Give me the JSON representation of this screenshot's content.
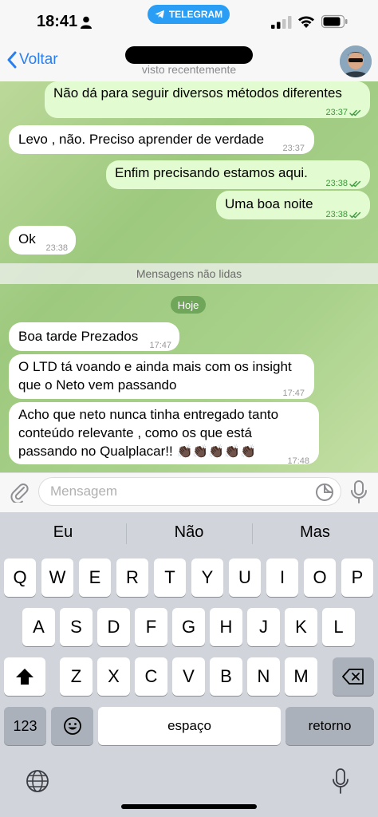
{
  "status_bar": {
    "time": "18:41",
    "app_pill": "TELEGRAM",
    "colors": {
      "pill": "#2a9df4"
    }
  },
  "header": {
    "back_label": "Voltar",
    "subtitle": "visto recentemente",
    "accent": "#2a7ff0"
  },
  "chat": {
    "messages": [
      {
        "dir": "out",
        "text": "Não dá para seguir diversos métodos diferentes",
        "time": "23:37"
      },
      {
        "dir": "in",
        "text": "Levo , não. Preciso aprender de verdade",
        "time": "23:37"
      },
      {
        "dir": "out",
        "text": "Enfim precisando estamos aqui.",
        "time": "23:38"
      },
      {
        "dir": "out",
        "text": "Uma boa noite",
        "time": "23:38"
      },
      {
        "dir": "in",
        "text": "Ok",
        "time": "23:38"
      },
      {
        "dir": "in",
        "text": "Boa tarde Prezados",
        "time": "17:47"
      },
      {
        "dir": "in",
        "line1": "O LTD tá voando e ainda mais com os insight",
        "line2": "que o Neto vem passando",
        "time": "17:47"
      },
      {
        "dir": "in",
        "line1": "Acho que neto nunca tinha entregado tanto",
        "line2": "conteúdo relevante , como os que está",
        "line3": "passando no Qualplacar!!",
        "emoji": "👏🏿👏🏿👏🏿👏🏿👏🏿",
        "time": "17:48"
      }
    ],
    "unread_label": "Mensagens não lidas",
    "date_label": "Hoje"
  },
  "composer": {
    "placeholder": "Mensagem"
  },
  "keyboard": {
    "suggestions": [
      "Eu",
      "Não",
      "Mas"
    ],
    "row1": [
      "Q",
      "W",
      "E",
      "R",
      "T",
      "Y",
      "U",
      "I",
      "O",
      "P"
    ],
    "row2": [
      "A",
      "S",
      "D",
      "F",
      "G",
      "H",
      "J",
      "K",
      "L"
    ],
    "row3": [
      "Z",
      "X",
      "C",
      "V",
      "B",
      "N",
      "M"
    ],
    "numbers_key": "123",
    "space_key": "espaço",
    "return_key": "retorno"
  }
}
